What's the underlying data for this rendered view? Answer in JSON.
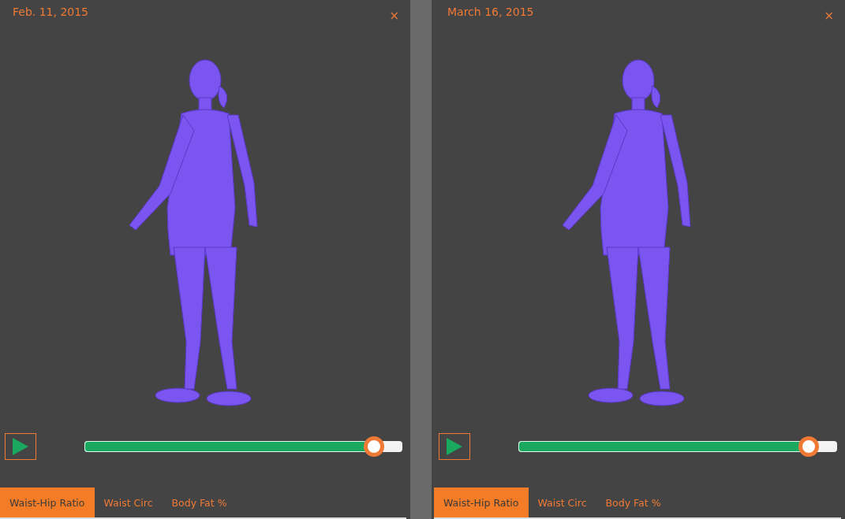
{
  "panels": [
    {
      "date": "Feb. 11, 2015",
      "close": "×",
      "slider": {
        "level": 0.91
      },
      "tabs": [
        {
          "label": "Waist-Hip Ratio",
          "selected": true
        },
        {
          "label": "Waist Circ",
          "selected": false
        },
        {
          "label": "Body Fat %",
          "selected": false
        }
      ]
    },
    {
      "date": "March 16, 2015",
      "close": "×",
      "slider": {
        "level": 0.91
      },
      "tabs": [
        {
          "label": "Waist-Hip Ratio",
          "selected": true
        },
        {
          "label": "Waist Circ",
          "selected": false
        },
        {
          "label": "Body Fat %",
          "selected": false
        }
      ]
    }
  ]
}
